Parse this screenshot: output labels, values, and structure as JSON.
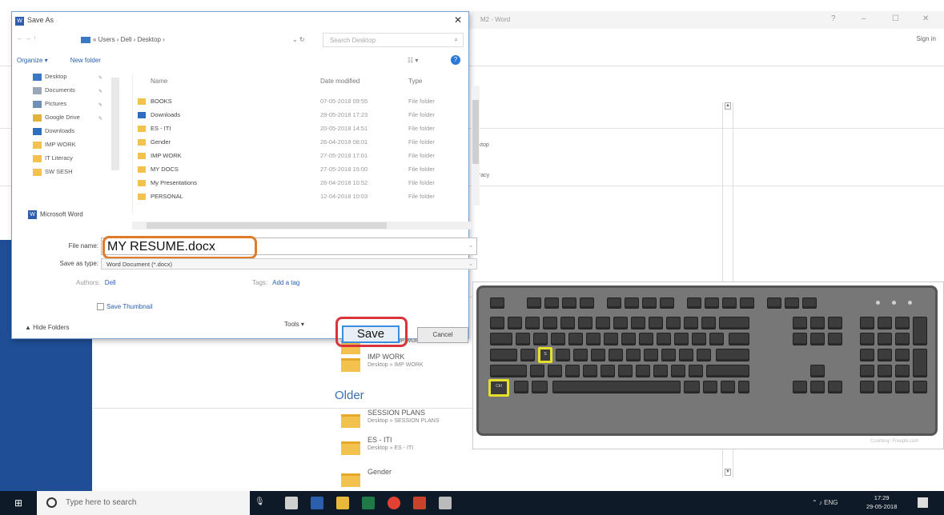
{
  "word": {
    "title": "M2 - Word",
    "window_controls": [
      "?",
      "–",
      "☐",
      "✕"
    ],
    "sign_in": "Sign in",
    "fragments": [
      "sktop",
      "eracy"
    ],
    "recent": [
      {
        "name": "",
        "path": "Desktop » IMP WORK » ES-TI"
      },
      {
        "name": "IMP WORK",
        "path": "Desktop » IMP WORK"
      },
      {
        "name": "SESSION PLANS",
        "path": "Desktop » SESSION PLANS"
      },
      {
        "name": "ES - ITI",
        "path": "Desktop » ES - ITI"
      },
      {
        "name": "Gender",
        "path": ""
      }
    ],
    "older_label": "Older",
    "picture_credit": "Courtesy: Freepik.com"
  },
  "dialog": {
    "title": "Save As",
    "close": "✕",
    "nav_arrows": "←  →  ↑",
    "address": "« Users › Dell › Desktop ›",
    "search_placeholder": "Search Desktop",
    "organize": "Organize ▾",
    "new_folder": "New folder",
    "nav_items": [
      {
        "label": "Desktop",
        "color": "#3b78c4"
      },
      {
        "label": "Documents",
        "color": "#9aa7b8"
      },
      {
        "label": "Pictures",
        "color": "#6f8fb5"
      },
      {
        "label": "Google Drive",
        "color": "#e0b43a"
      },
      {
        "label": "Downloads",
        "color": "#2f6fc1"
      },
      {
        "label": "IMP WORK",
        "color": "#f2c14e"
      },
      {
        "label": "IT Literacy",
        "color": "#f2c14e"
      },
      {
        "label": "SW SESH",
        "color": "#f2c14e"
      }
    ],
    "microsoft_word": "Microsoft Word",
    "columns": {
      "name": "Name",
      "date": "Date modified",
      "type": "Type"
    },
    "files": [
      {
        "name": "BOOKS",
        "date": "07-05-2018 09:55",
        "type": "File folder"
      },
      {
        "name": "Downloads",
        "date": "29-05-2018 17:23",
        "type": "File folder"
      },
      {
        "name": "ES - ITI",
        "date": "20-05-2018 14:51",
        "type": "File folder"
      },
      {
        "name": "Gender",
        "date": "26-04-2018 08:01",
        "type": "File folder"
      },
      {
        "name": "IMP WORK",
        "date": "27-05-2018 17:01",
        "type": "File folder"
      },
      {
        "name": "MY DOCS",
        "date": "27-05-2018 15:00",
        "type": "File folder"
      },
      {
        "name": "My Presentations",
        "date": "26-04-2018 10:52",
        "type": "File folder"
      },
      {
        "name": "PERSONAL",
        "date": "12-04-2018 10:03",
        "type": "File folder"
      }
    ],
    "file_name_label": "File name:",
    "file_name_value": "MY RESUME.docx",
    "save_type_label": "Save as type:",
    "save_type_value": "Word Document (*.docx)",
    "authors_label": "Authors:",
    "authors_value": "Dell",
    "tags_label": "Tags:",
    "tags_value": "Add a tag",
    "save_thumbnail": "Save Thumbnail",
    "hide_folders": "▲ Hide Folders",
    "tools": "Tools ▾",
    "save": "Save",
    "cancel": "Cancel"
  },
  "keyboard": {
    "key_s": "S",
    "key_ctrl": "Ctrl",
    "highlight_color": "#e6e02a"
  },
  "taskbar": {
    "search_placeholder": "Type here to search",
    "tray": "⌃ ♪ ENG",
    "time": "17:29",
    "date": "29-05-2018",
    "icons": [
      {
        "name": "task-view",
        "color": "#cfcfcf"
      },
      {
        "name": "word",
        "color": "#2b5fad"
      },
      {
        "name": "file-explorer",
        "color": "#e8b83a"
      },
      {
        "name": "excel",
        "color": "#1f7a45"
      },
      {
        "name": "chrome",
        "color": "#e34133"
      },
      {
        "name": "powerpoint",
        "color": "#c9432b"
      },
      {
        "name": "pen",
        "color": "#bbbbbb"
      }
    ]
  }
}
